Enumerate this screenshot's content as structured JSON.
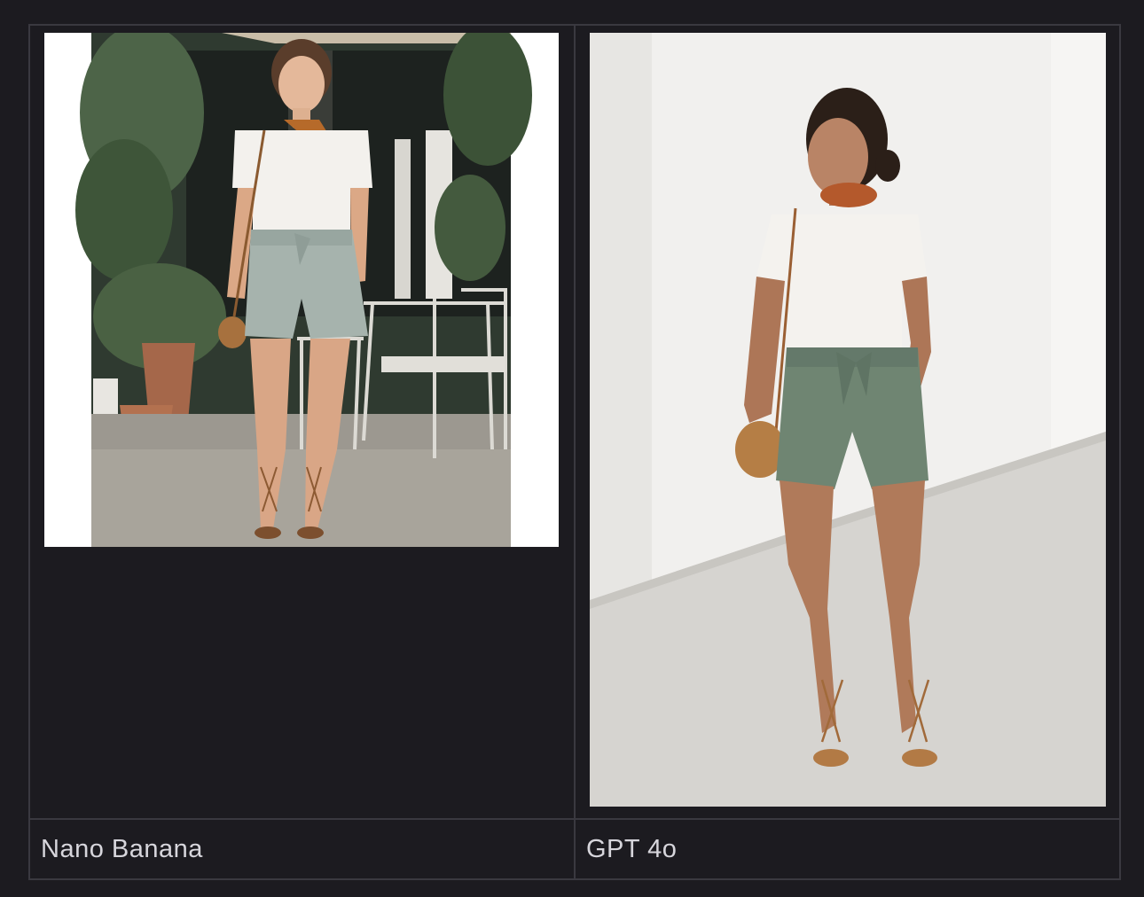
{
  "comparison": {
    "columns": [
      {
        "caption": "Nano Banana",
        "image": "photo-woman-white-tee-sage-shorts-cafe"
      },
      {
        "caption": "GPT 4o",
        "image": "photo-woman-white-tee-olive-shorts-studio"
      }
    ]
  },
  "colors": {
    "background": "#1c1b20",
    "grid_line": "#3a3940",
    "caption_text": "#d7d6dc"
  }
}
